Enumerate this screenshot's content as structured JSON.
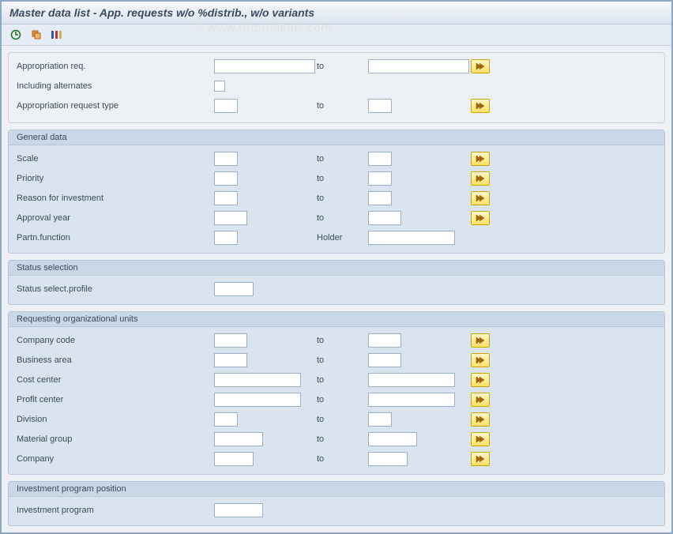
{
  "window": {
    "title": "Master data list - App. requests w/o %distrib., w/o variants"
  },
  "watermark": {
    "copy": "©",
    "text": "www.tutorialkart.com"
  },
  "toolbar": {
    "execute_icon": "⊕",
    "copy_icon": "⎘",
    "settings_icon": "☰"
  },
  "labels": {
    "to": "to"
  },
  "top_section": {
    "appropriation_req": {
      "label": "Appropriation req.",
      "from": "",
      "to": "",
      "has_more": true
    },
    "including_alternates": {
      "label": "Including alternates",
      "value": false
    },
    "appropriation_request_type": {
      "label": "Appropriation request type",
      "from": "",
      "to": "",
      "has_more": true
    }
  },
  "general_data": {
    "title": "General data",
    "scale": {
      "label": "Scale",
      "from": "",
      "to": "",
      "has_more": true
    },
    "priority": {
      "label": "Priority",
      "from": "",
      "to": "",
      "has_more": true
    },
    "reason_for_investment": {
      "label": "Reason for investment",
      "from": "",
      "to": "",
      "has_more": true
    },
    "approval_year": {
      "label": "Approval year",
      "from": "",
      "to": "",
      "has_more": true
    },
    "partn_function": {
      "label": "Partn.function",
      "from": "",
      "holder_label": "Holder",
      "holder": ""
    }
  },
  "status_selection": {
    "title": "Status selection",
    "status_select_profile": {
      "label": "Status select.profile",
      "value": ""
    }
  },
  "requesting_org_units": {
    "title": "Requesting organizational units",
    "company_code": {
      "label": "Company code",
      "from": "",
      "to": "",
      "has_more": true
    },
    "business_area": {
      "label": "Business area",
      "from": "",
      "to": "",
      "has_more": true
    },
    "cost_center": {
      "label": "Cost center",
      "from": "",
      "to": "",
      "has_more": true
    },
    "profit_center": {
      "label": "Profit center",
      "from": "",
      "to": "",
      "has_more": true
    },
    "division": {
      "label": "Division",
      "from": "",
      "to": "",
      "has_more": true
    },
    "material_group": {
      "label": "Material group",
      "from": "",
      "to": "",
      "has_more": true
    },
    "company": {
      "label": "Company",
      "from": "",
      "to": "",
      "has_more": true
    }
  },
  "investment_program_position": {
    "title": "Investment program position",
    "investment_program": {
      "label": "Investment program",
      "value": ""
    }
  }
}
